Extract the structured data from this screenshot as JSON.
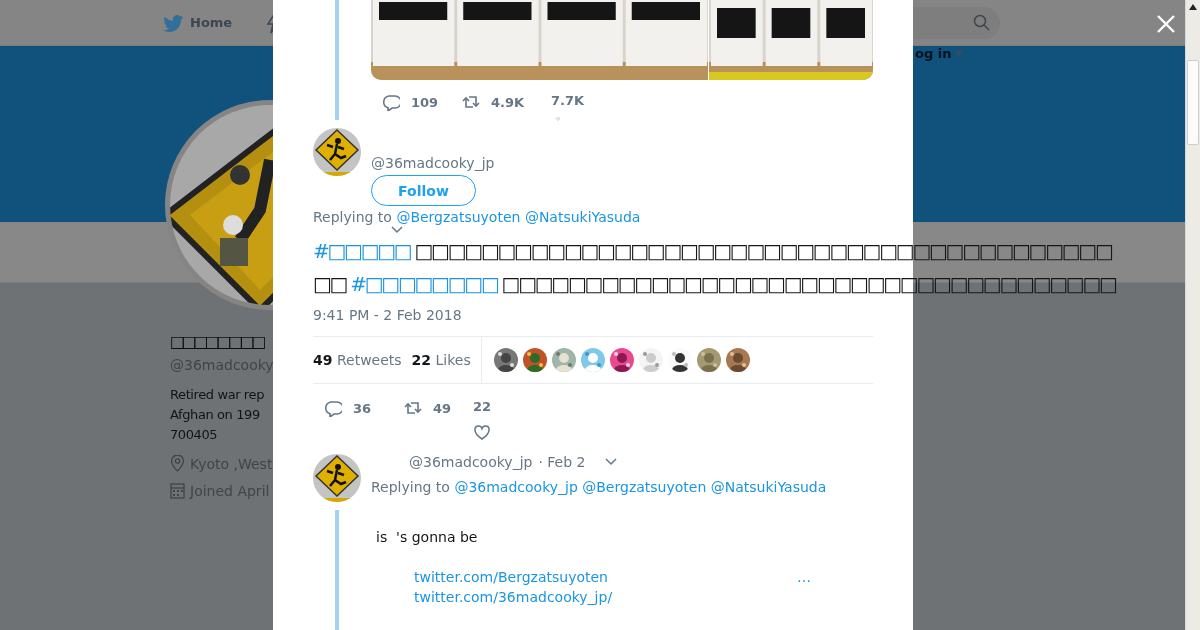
{
  "page": {
    "nav": {
      "home_label": "Home",
      "login_label": "og in"
    },
    "profile": {
      "name": "□□□□□□□□",
      "handle": "@36madcooky",
      "bio_lines": [
        "Retired war rep",
        "Afghan on 199",
        "700405"
      ],
      "location": "Kyoto ,West",
      "joined": "Joined April"
    }
  },
  "modal": {
    "previous_tweet": {
      "photos": [
        {
          "kind": "picture"
        },
        {
          "kind": "picture"
        }
      ],
      "actions": [
        {
          "kind": "reply",
          "count": "109"
        },
        {
          "kind": "retweet",
          "count": "4.9K"
        },
        {
          "kind": "like",
          "count": "7.7K"
        }
      ]
    },
    "tweet": {
      "handle": "@36madcooky_jp",
      "follow_label": "Follow",
      "replying_prefix": "Replying to",
      "replying_to": [
        "@Bergzatsuyoten",
        "@NatsukiYasuda"
      ],
      "lines": [
        [
          {
            "kind": "hashtag",
            "text": "#□□□□□"
          },
          {
            "kind": "text",
            "text": " □□□□□□□□□□□□□□□□□□□□□□□□□□□□□□□□□□□□□□□□□□"
          }
        ],
        [
          {
            "kind": "text",
            "text": "□□ "
          },
          {
            "kind": "hashtag",
            "text": "#□□□□□□□□"
          },
          {
            "kind": "text",
            "text": " □□□□□□□□□□□□□□□□□□□□□□□□□□□□□□□□□□□□□"
          }
        ]
      ],
      "timestamp": "9:41 PM - 2 Feb 2018",
      "retweets": {
        "count": "49",
        "label": "Retweets"
      },
      "likes": {
        "count": "22",
        "label": "Likes"
      },
      "likers": [
        {
          "kind": "picture"
        },
        {
          "kind": "picture"
        },
        {
          "kind": "picture"
        },
        {
          "kind": "picture"
        },
        {
          "kind": "picture"
        },
        {
          "kind": "picture"
        },
        {
          "kind": "picture"
        },
        {
          "kind": "picture"
        },
        {
          "kind": "picture"
        }
      ],
      "actions": [
        {
          "kind": "reply",
          "count": "36"
        },
        {
          "kind": "retweet",
          "count": "49"
        },
        {
          "kind": "like",
          "count": "22"
        }
      ]
    },
    "reply": {
      "handle": "@36madcooky_jp",
      "date": "· Feb 2",
      "replying_prefix": "Replying to",
      "replying_to": [
        "@36madcooky_jp",
        "@Bergzatsuyoten",
        "@NatsukiYasuda"
      ],
      "text": "is  's gonna be",
      "links": [
        {
          "text": "twitter.com/Bergzatsuyoten",
          "ellipsis": "…"
        },
        {
          "text": "twitter.com/36madcooky_jp/"
        }
      ]
    }
  }
}
